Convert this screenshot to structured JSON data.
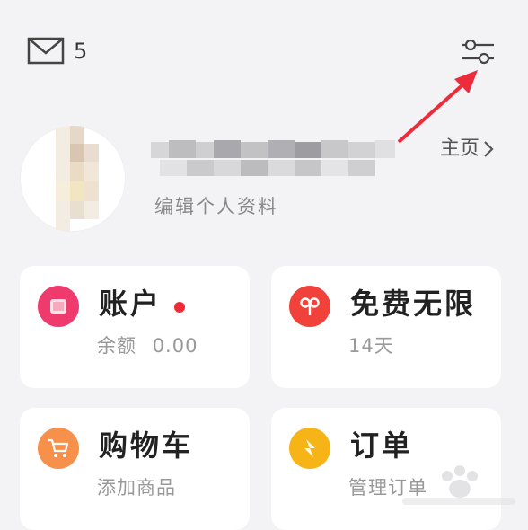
{
  "header": {
    "mail_count": "5"
  },
  "profile": {
    "home_label": "主页",
    "edit_label": "编辑个人资料"
  },
  "cards": {
    "account": {
      "title": "账户",
      "balance_label": "余额",
      "balance_value": "0.00"
    },
    "free": {
      "title": "免费无限",
      "subtitle": "14天"
    },
    "cart": {
      "title": "购物车",
      "subtitle": "添加商品"
    },
    "orders": {
      "title": "订单",
      "subtitle": "管理订单"
    }
  },
  "colors": {
    "accent_red": "#ee2b3a",
    "account_icon": "#ee3a6c",
    "free_icon": "#f0413a",
    "cart_icon": "#f7904a",
    "orders_icon": "#f6b416"
  },
  "icons": [
    "mail-icon",
    "settings-sliders-icon",
    "chevron-right-icon",
    "account-icon",
    "free-infinite-icon",
    "cart-icon",
    "orders-icon"
  ]
}
